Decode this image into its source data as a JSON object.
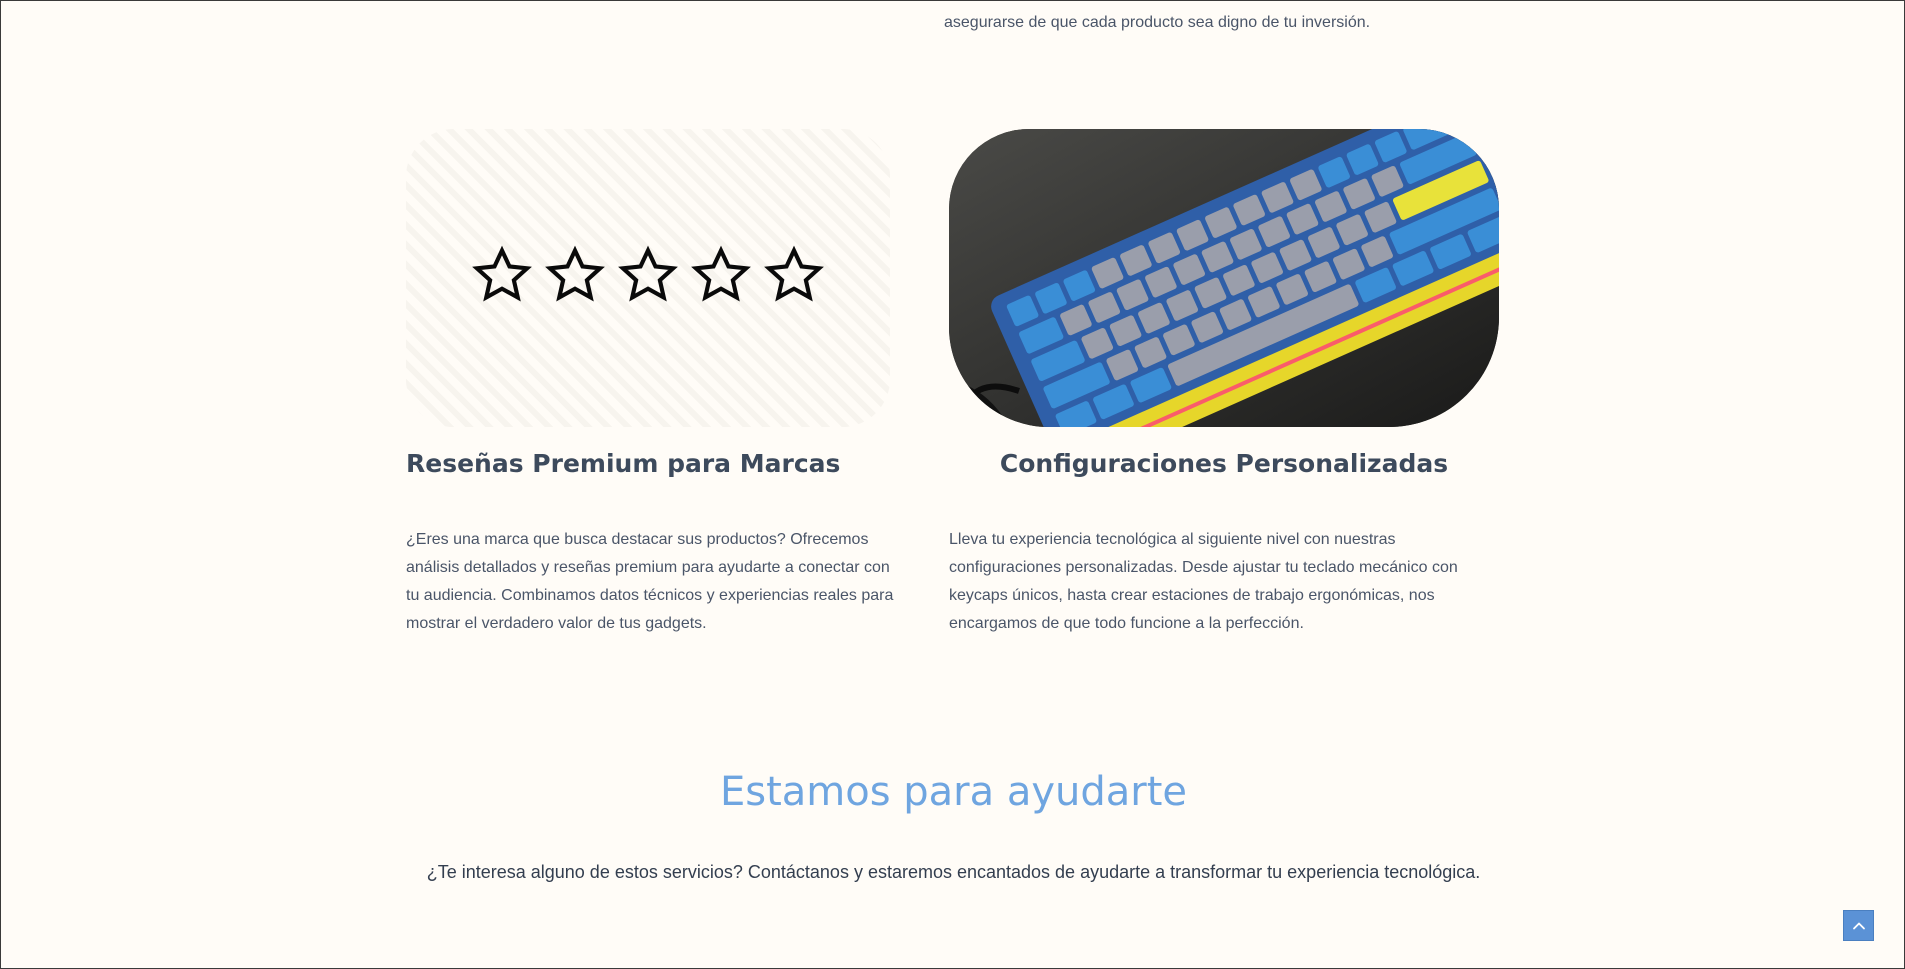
{
  "intro": {
    "text": "asegurarse de que cada producto sea digno de tu inversión."
  },
  "services": [
    {
      "title": "Reseñas Premium para Marcas",
      "description": "¿Eres una marca que busca destacar sus productos? Ofrecemos análisis detallados y reseñas premium para ayudarte a conectar con tu audiencia. Combinamos datos técnicos y experiencias reales para mostrar el verdadero valor de tus gadgets.",
      "media": "five-star-rating-icons"
    },
    {
      "title": "Configuraciones Personalizadas",
      "description": "Lleva tu experiencia tecnológica al siguiente nivel con nuestras configuraciones personalizadas. Desde ajustar tu teclado mecánico con keycaps únicos, hasta crear estaciones de trabajo ergonómicas, nos encargamos de que todo funcione a la perfección.",
      "media": "mechanical-keyboard-photo"
    }
  ],
  "contact": {
    "title": "Estamos para ayudarte",
    "text": "¿Te interesa alguno de estos servicios? Contáctanos y estaremos encantados de ayudarte a transformar tu experiencia tecnológica."
  },
  "colors": {
    "background": "#fffcf7",
    "accent": "#6fa5e0",
    "heading": "#3d4a5c",
    "scroll_button": "#5b92d6"
  },
  "scroll_top_icon": "chevron-up-icon"
}
